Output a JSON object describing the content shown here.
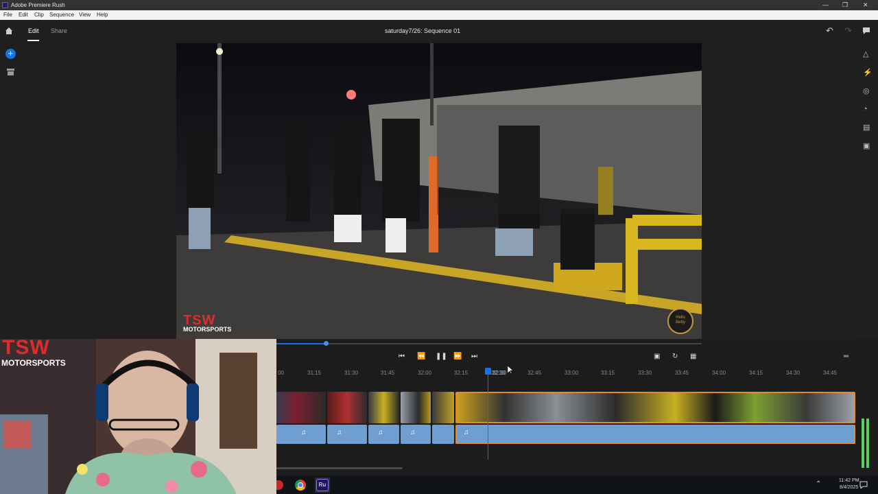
{
  "window": {
    "title": "Adobe Premiere Rush",
    "app_badge": "Ru"
  },
  "menu": [
    "File",
    "Edit",
    "Clip",
    "Sequence",
    "View",
    "Help"
  ],
  "appbar": {
    "tabs": [
      {
        "label": "Edit",
        "active": true
      },
      {
        "label": "Share",
        "active": false
      }
    ],
    "sequence_title": "saturday7/26: Sequence 01"
  },
  "preview": {
    "watermark_line1": "TSW",
    "watermark_line2": "MOTORSPORTS",
    "badge": "Hello Betty"
  },
  "webcam": {
    "logo_line1": "TSW",
    "logo_line2": "MOTORSPORTS"
  },
  "timeline": {
    "ruler": [
      "00",
      "31:15",
      "31:30",
      "31:45",
      "32:00",
      "32:15",
      "32:30",
      "32:45",
      "33:00",
      "33:15",
      "33:30",
      "33:45",
      "34:00",
      "34:15",
      "34:30",
      "34:45"
    ],
    "playhead_label": "32:30"
  },
  "taskbar": {
    "time": "11:42 PM",
    "date": "8/4/2025"
  },
  "colors": {
    "accent": "#1473e6",
    "clip_selected": "#e8892b",
    "audio": "#6f9fd1"
  }
}
